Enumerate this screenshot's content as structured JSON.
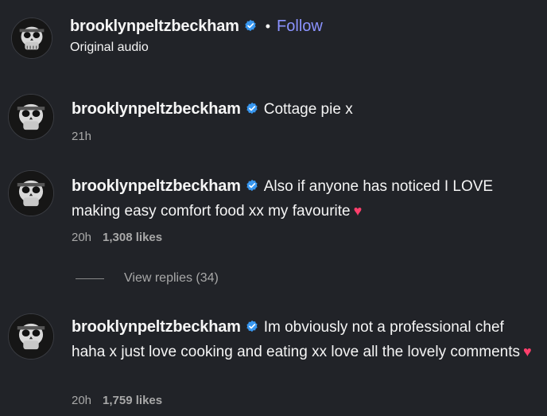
{
  "header": {
    "username": "brooklynpeltzbeckham",
    "separator": "•",
    "follow_label": "Follow",
    "subtitle": "Original audio"
  },
  "comments": [
    {
      "username": "brooklynpeltzbeckham",
      "text": "Cottage pie x",
      "time": "21h",
      "likes": ""
    },
    {
      "username": "brooklynpeltzbeckham",
      "text": "Also if anyone has noticed I LOVE making easy comfort food xx my favourite",
      "time": "20h",
      "likes": "1,308 likes"
    },
    {
      "username": "brooklynpeltzbeckham",
      "text": "Im obviously not a professional chef haha x just love cooking and eating xx love all the lovely comments",
      "time": "20h",
      "likes": "1,759 likes"
    }
  ],
  "view_replies_label": "View replies (34)",
  "colors": {
    "background": "#212328",
    "link": "#8b93ff",
    "verified": "#3897f0",
    "heart": "#ff3f6c",
    "muted": "#a8a8a8"
  },
  "icons": {
    "verified": "verified-badge-icon",
    "heart": "heart-icon",
    "avatar": "skull-avatar-icon"
  }
}
